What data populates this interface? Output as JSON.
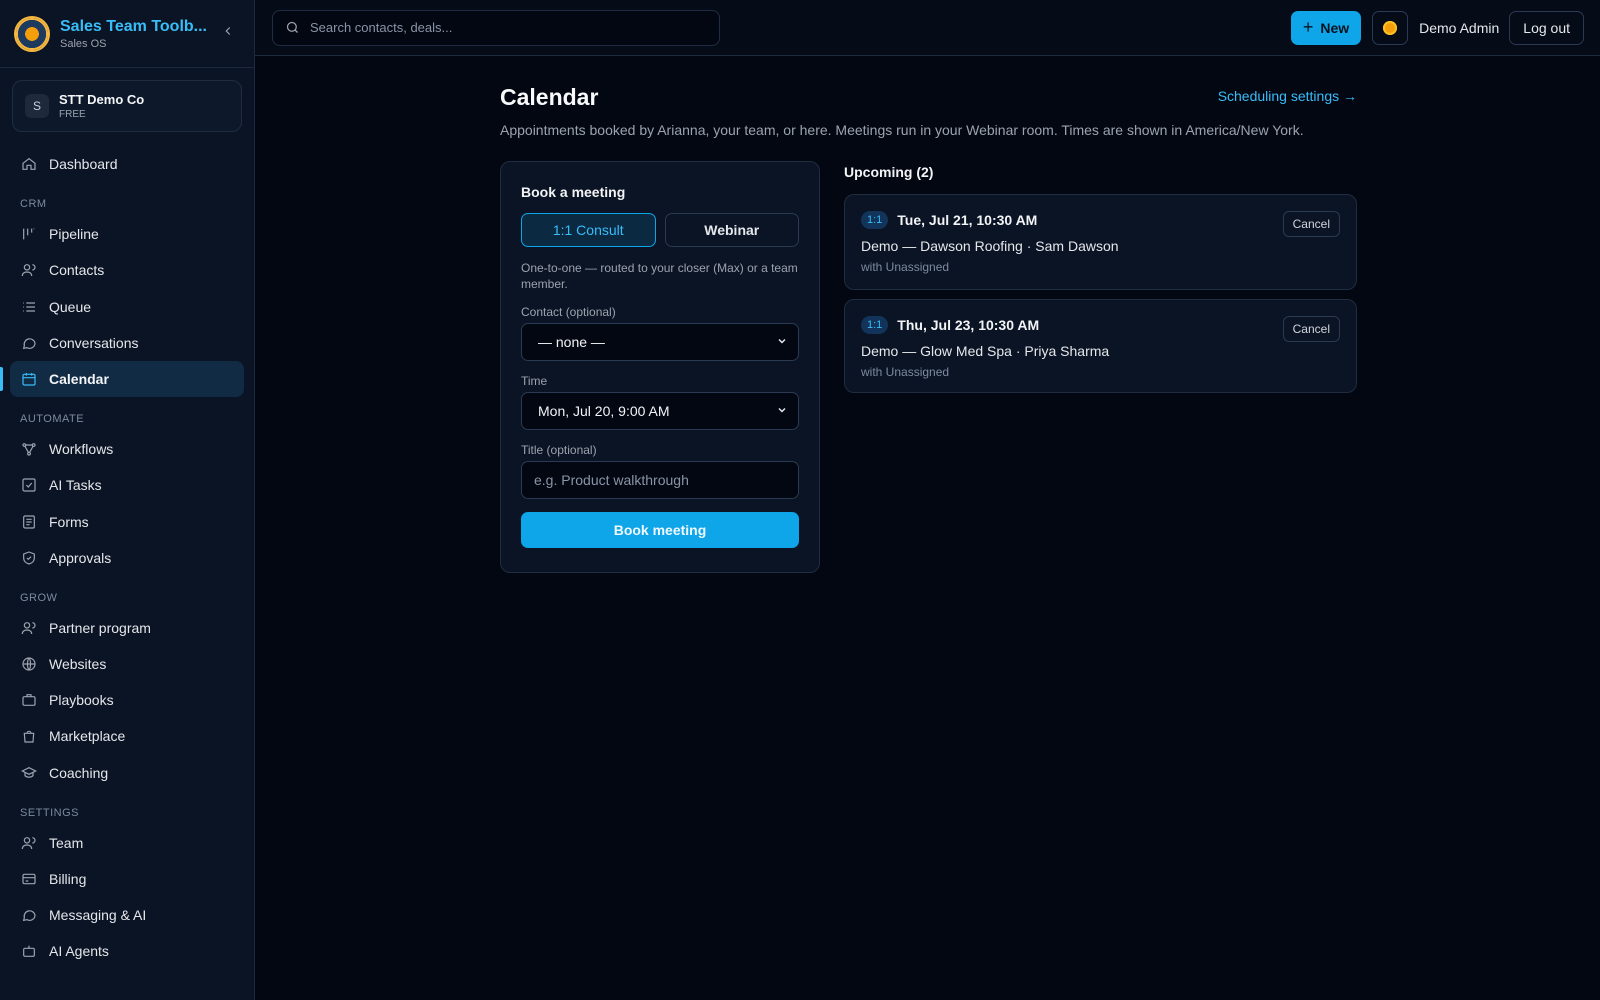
{
  "brand": {
    "title": "Sales Team Toolb...",
    "subtitle": "Sales OS"
  },
  "org": {
    "initial": "S",
    "name": "STT Demo Co",
    "plan": "FREE"
  },
  "nav": {
    "dashboard": "Dashboard",
    "crm_label": "CRM",
    "crm": [
      {
        "label": "Pipeline",
        "icon": "pipeline-icon"
      },
      {
        "label": "Contacts",
        "icon": "contacts-icon"
      },
      {
        "label": "Queue",
        "icon": "queue-icon"
      },
      {
        "label": "Conversations",
        "icon": "conversations-icon"
      },
      {
        "label": "Calendar",
        "icon": "calendar-icon",
        "active": true
      }
    ],
    "automate_label": "AUTOMATE",
    "automate": [
      {
        "label": "Workflows",
        "icon": "workflows-icon"
      },
      {
        "label": "AI Tasks",
        "icon": "ai-tasks-icon"
      },
      {
        "label": "Forms",
        "icon": "forms-icon"
      },
      {
        "label": "Approvals",
        "icon": "approvals-icon"
      }
    ],
    "grow_label": "GROW",
    "grow": [
      {
        "label": "Partner program",
        "icon": "partner-icon"
      },
      {
        "label": "Websites",
        "icon": "globe-icon"
      },
      {
        "label": "Playbooks",
        "icon": "playbooks-icon"
      },
      {
        "label": "Marketplace",
        "icon": "marketplace-icon"
      },
      {
        "label": "Coaching",
        "icon": "coaching-icon"
      }
    ],
    "settings_label": "SETTINGS",
    "settings": [
      {
        "label": "Team",
        "icon": "team-icon"
      },
      {
        "label": "Billing",
        "icon": "billing-icon"
      },
      {
        "label": "Messaging & AI",
        "icon": "messaging-icon"
      },
      {
        "label": "AI Agents",
        "icon": "ai-agents-icon"
      }
    ]
  },
  "topbar": {
    "search_placeholder": "Search contacts, deals...",
    "new_label": "New",
    "user_name": "Demo Admin",
    "logout_label": "Log out"
  },
  "page": {
    "title": "Calendar",
    "settings_link": "Scheduling settings →",
    "description": "Appointments booked by Arianna, your team, or here. Meetings run in your Webinar room. Times are shown in America/New York."
  },
  "booking": {
    "title": "Book a meeting",
    "types": [
      "1:1 Consult",
      "Webinar"
    ],
    "selected_type": "1:1 Consult",
    "type_description": "One-to-one — routed to your closer (Max) or a team member.",
    "contact_label": "Contact (optional)",
    "contact_value": "— none —",
    "time_label": "Time",
    "time_value": "Mon, Jul 20, 9:00 AM",
    "title_label": "Title (optional)",
    "title_placeholder": "e.g. Product walkthrough",
    "submit_label": "Book meeting"
  },
  "upcoming": {
    "heading": "Upcoming (2)",
    "items": [
      {
        "badge": "1:1",
        "when": "Tue, Jul 21, 10:30 AM",
        "title": "Demo — Dawson Roofing · Sam Dawson",
        "with": "with Unassigned",
        "cancel": "Cancel"
      },
      {
        "badge": "1:1",
        "when": "Thu, Jul 23, 10:30 AM",
        "title": "Demo — Glow Med Spa · Priya Sharma",
        "with": "with Unassigned",
        "cancel": "Cancel"
      }
    ]
  },
  "colors": {
    "accent": "#0ea5e9",
    "link": "#38bdf8",
    "background": "#030712",
    "panel": "#0b1424"
  }
}
